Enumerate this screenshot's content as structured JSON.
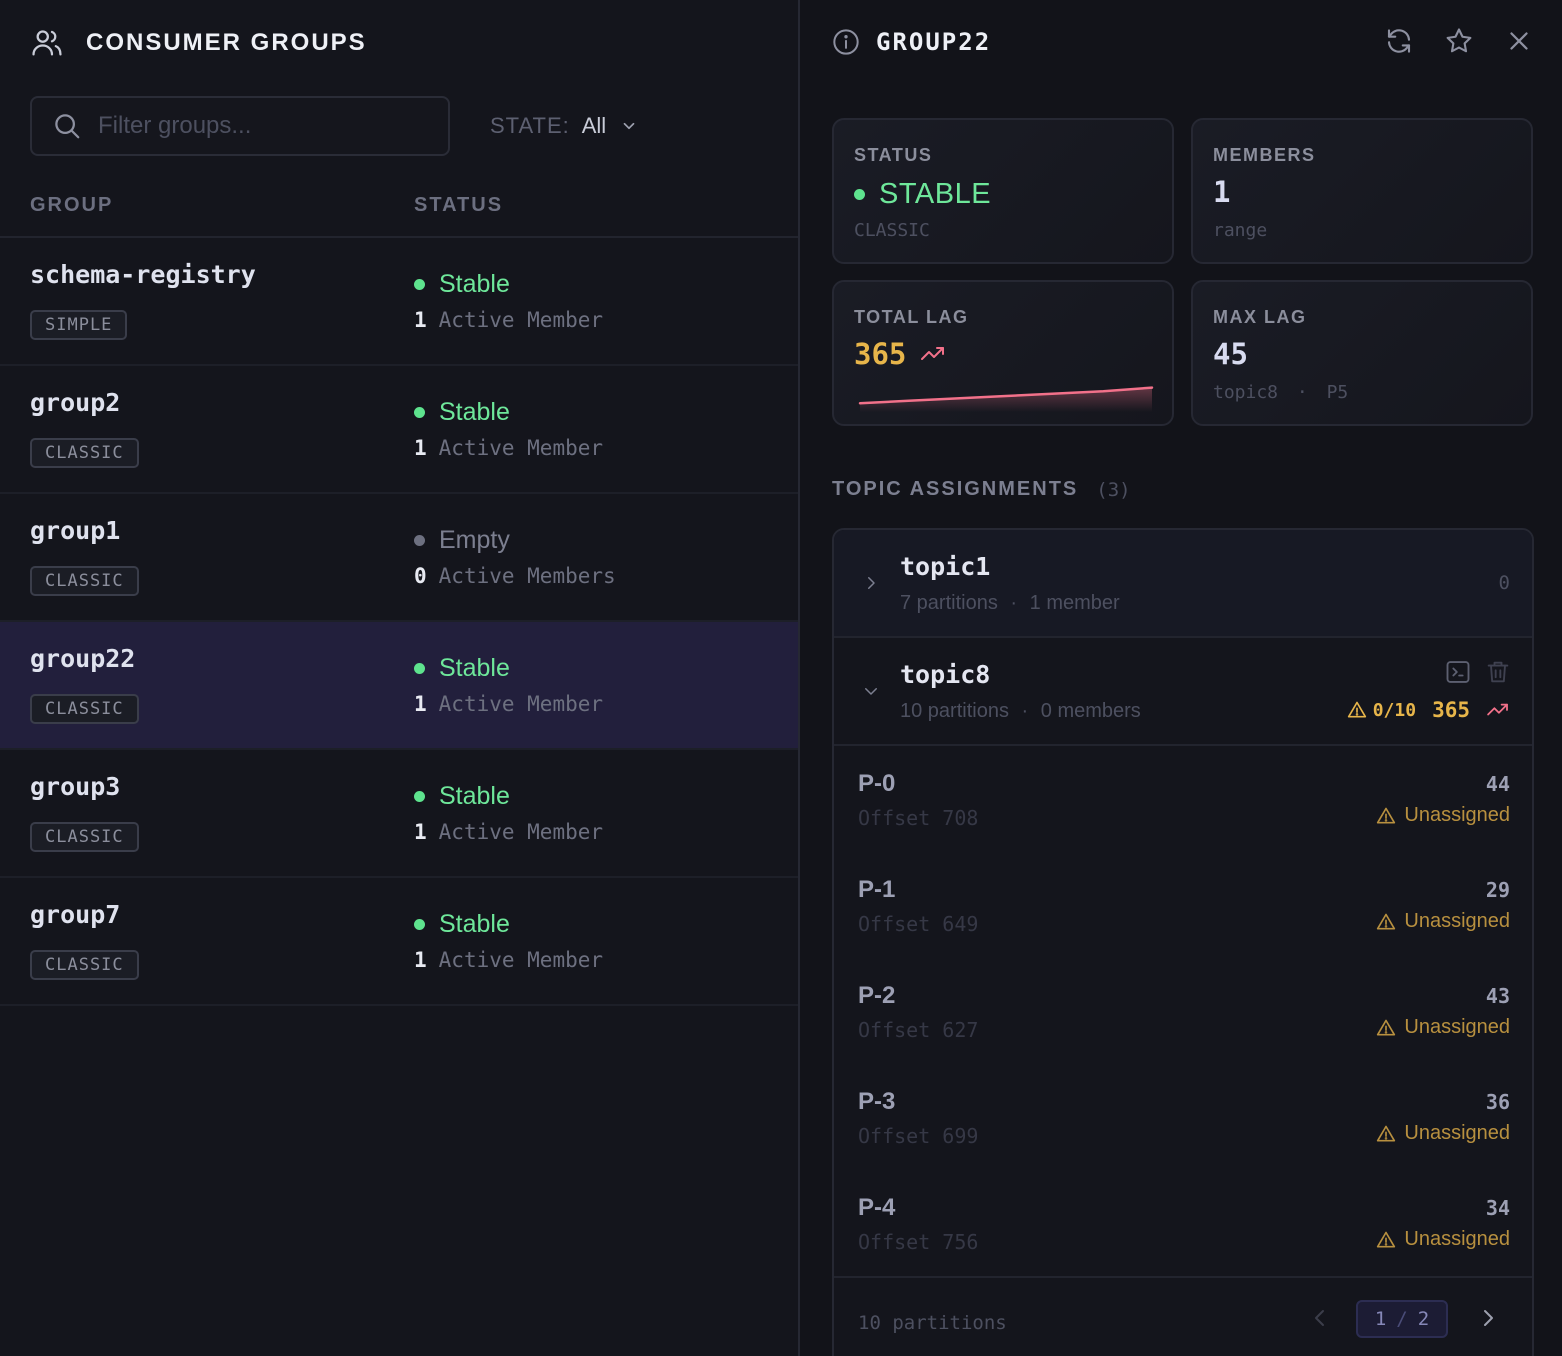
{
  "colors": {
    "stable": "#5ee38e",
    "empty": "#6d7080",
    "warn": "#e7b54a",
    "trend": "#f2718a",
    "selected_row": "#221f3c"
  },
  "left": {
    "title": "CONSUMER GROUPS",
    "search": {
      "placeholder": "Filter groups..."
    },
    "state_filter": {
      "label": "STATE:",
      "value": "All"
    },
    "columns": {
      "group": "GROUP",
      "status": "STATUS"
    },
    "groups": [
      {
        "name": "schema-registry",
        "protocol": "SIMPLE",
        "status": "Stable",
        "members": "1",
        "members_label": "Active Member",
        "selected": false
      },
      {
        "name": "group2",
        "protocol": "CLASSIC",
        "status": "Stable",
        "members": "1",
        "members_label": "Active Member",
        "selected": false
      },
      {
        "name": "group1",
        "protocol": "CLASSIC",
        "status": "Empty",
        "members": "0",
        "members_label": "Active Members",
        "selected": false
      },
      {
        "name": "group22",
        "protocol": "CLASSIC",
        "status": "Stable",
        "members": "1",
        "members_label": "Active Member",
        "selected": true
      },
      {
        "name": "group3",
        "protocol": "CLASSIC",
        "status": "Stable",
        "members": "1",
        "members_label": "Active Member",
        "selected": false
      },
      {
        "name": "group7",
        "protocol": "CLASSIC",
        "status": "Stable",
        "members": "1",
        "members_label": "Active Member",
        "selected": false
      }
    ]
  },
  "detail": {
    "title": "GROUP22",
    "cards": {
      "status": {
        "label": "STATUS",
        "value": "STABLE",
        "sub": "CLASSIC"
      },
      "members": {
        "label": "MEMBERS",
        "value": "1",
        "sub": "range"
      },
      "total_lag": {
        "label": "TOTAL LAG",
        "value": "365",
        "sparkline": [
          0.2,
          0.3,
          0.4,
          0.5,
          0.6,
          0.7,
          0.85
        ]
      },
      "max_lag": {
        "label": "MAX LAG",
        "value": "45",
        "sub_topic": "topic8",
        "sub_sep": "·",
        "sub_partition": "P5"
      }
    },
    "topic_assignments": {
      "title": "TOPIC ASSIGNMENTS",
      "count": "(3)",
      "topics": [
        {
          "name": "topic1",
          "partitions": "7 partitions",
          "sep": "·",
          "members": "1 member",
          "lag": "0",
          "expanded": false
        },
        {
          "name": "topic8",
          "partitions": "10 partitions",
          "sep": "·",
          "members": "0 members",
          "assigned": "0/10",
          "lag": "365",
          "expanded": true
        }
      ],
      "partitions": [
        {
          "name": "P-0",
          "offset": "Offset 708",
          "lag": "44",
          "status": "Unassigned"
        },
        {
          "name": "P-1",
          "offset": "Offset 649",
          "lag": "29",
          "status": "Unassigned"
        },
        {
          "name": "P-2",
          "offset": "Offset 627",
          "lag": "43",
          "status": "Unassigned"
        },
        {
          "name": "P-3",
          "offset": "Offset 699",
          "lag": "36",
          "status": "Unassigned"
        },
        {
          "name": "P-4",
          "offset": "Offset 756",
          "lag": "34",
          "status": "Unassigned"
        }
      ],
      "footer": {
        "label": "10 partitions",
        "page_current": "1",
        "page_sep": "/",
        "page_total": "2"
      }
    }
  }
}
